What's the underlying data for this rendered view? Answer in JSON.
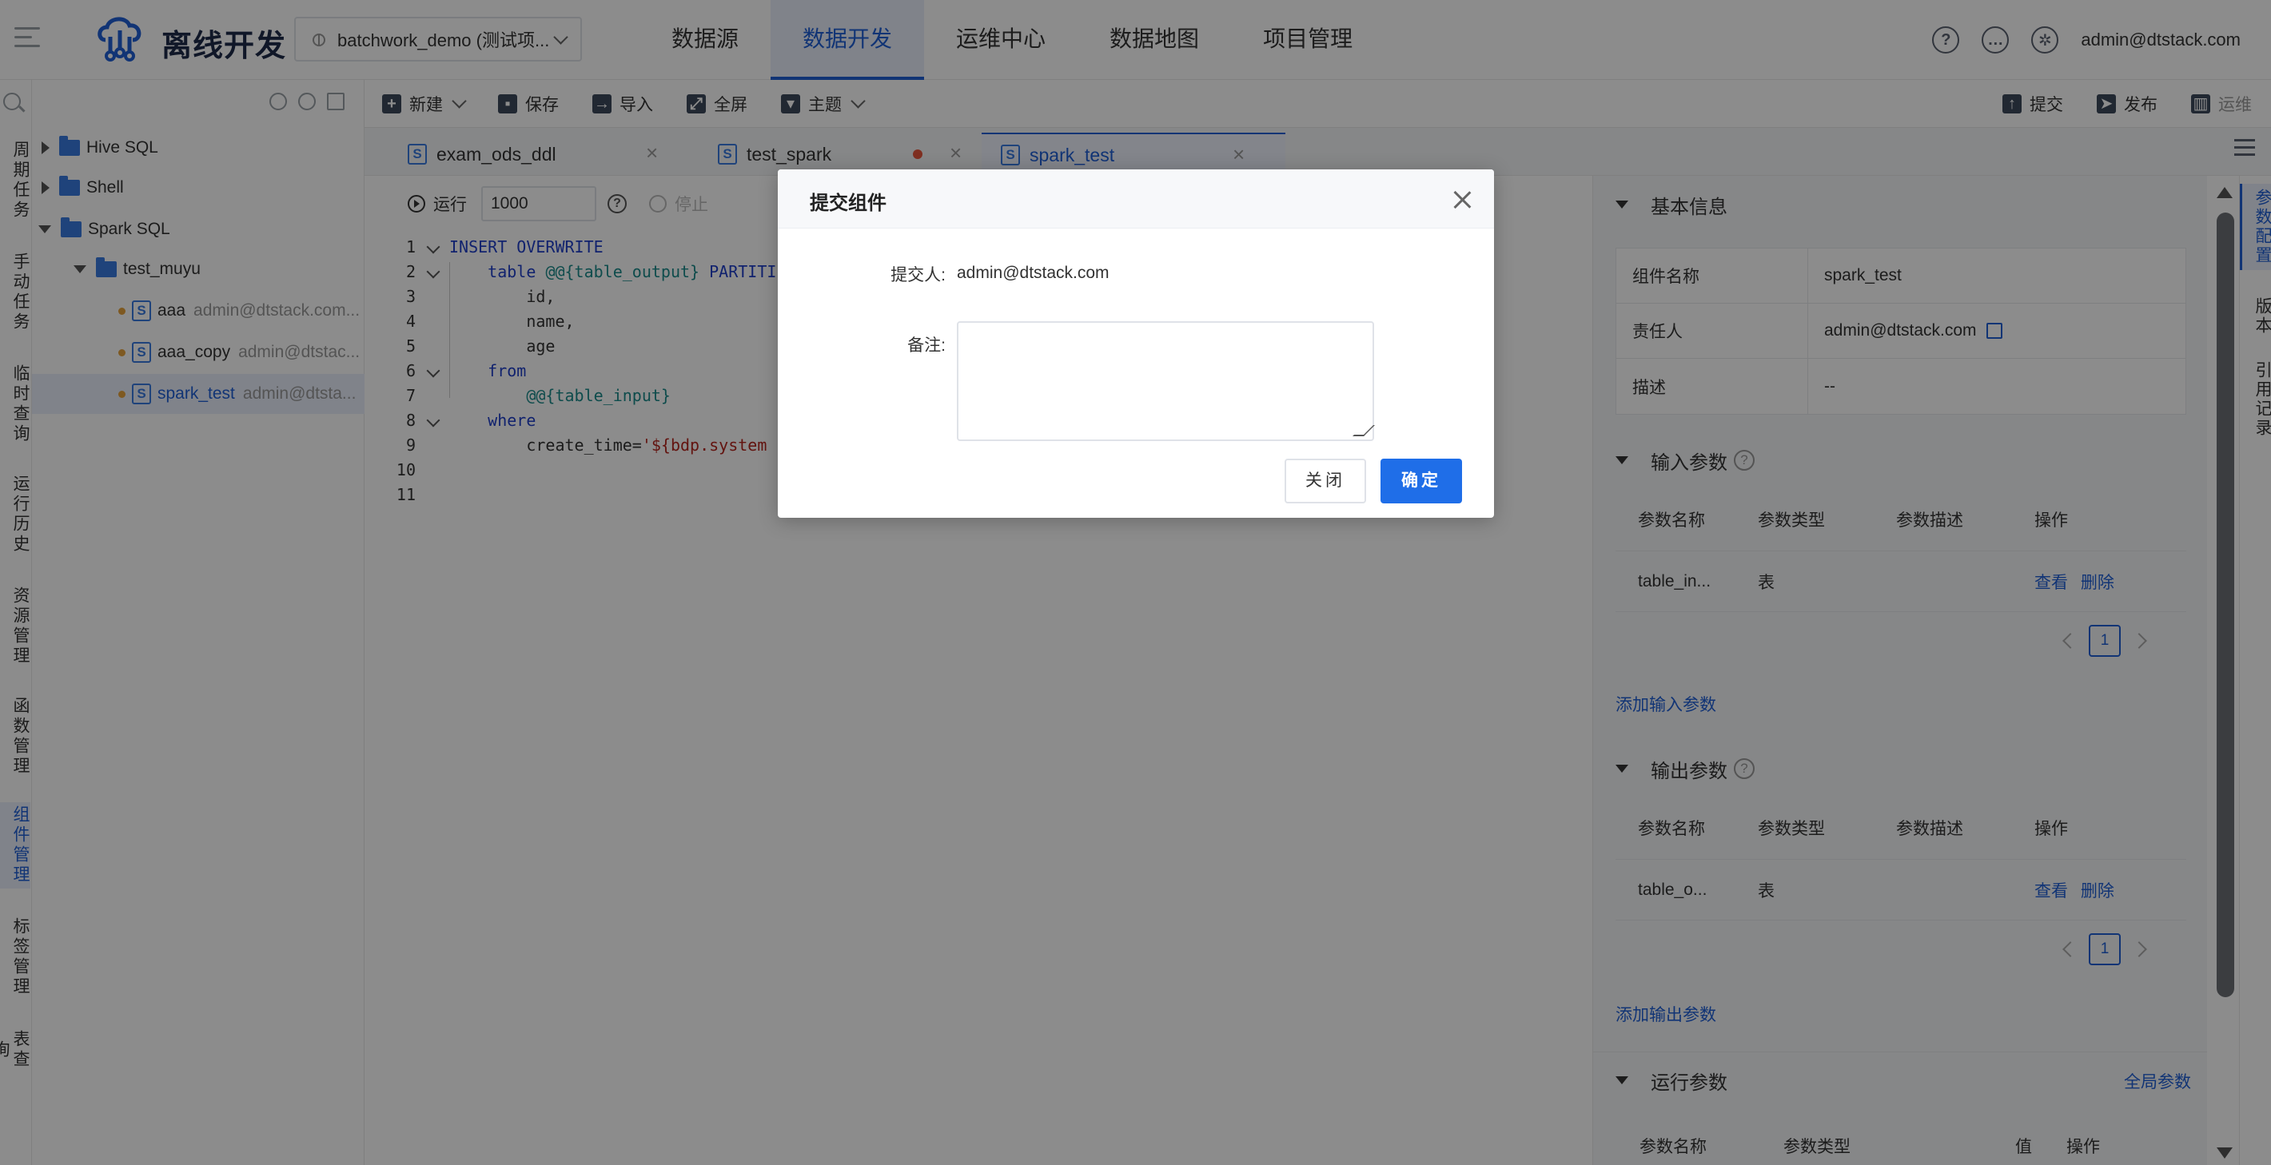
{
  "app": {
    "title": "离线开发",
    "project": "batchwork_demo (测试项..."
  },
  "nav": [
    "数据源",
    "数据开发",
    "运维中心",
    "数据地图",
    "项目管理"
  ],
  "user": {
    "email": "admin@dtstack.com"
  },
  "left_rail": [
    "周期任务",
    "手动任务",
    "临时查询",
    "运行历史",
    "资源管理",
    "函数管理",
    "组件管理",
    "标签管理",
    "表查询"
  ],
  "tree": {
    "folders": [
      "Hive SQL",
      "Shell",
      "Spark SQL",
      "test_muyu"
    ],
    "files": [
      {
        "name": "aaa",
        "owner": "admin@dtstack.com..."
      },
      {
        "name": "aaa_copy",
        "owner": "admin@dtstac..."
      },
      {
        "name": "spark_test",
        "owner": "admin@dtsta..."
      }
    ]
  },
  "toolbar": {
    "new": "新建",
    "save": "保存",
    "import": "导入",
    "fullscreen": "全屏",
    "theme": "主题",
    "submit": "提交",
    "publish": "发布",
    "ops": "运维"
  },
  "tabs": [
    "exam_ods_ddl",
    "test_spark",
    "spark_test"
  ],
  "editor": {
    "run": "运行",
    "limit": "1000",
    "stop": "停止",
    "lines": [
      {
        "n": "1",
        "parts": [
          [
            "kw",
            "INSERT OVERWRITE"
          ]
        ]
      },
      {
        "n": "2",
        "parts": [
          [
            "",
            "    "
          ],
          [
            "kw",
            "table"
          ],
          [
            "",
            " "
          ],
          [
            "var",
            "@@{table_output}"
          ],
          [
            "",
            " "
          ],
          [
            "kw",
            "PARTITI"
          ]
        ]
      },
      {
        "n": "3",
        "parts": [
          [
            "",
            "        id,"
          ]
        ]
      },
      {
        "n": "4",
        "parts": [
          [
            "",
            "        name,"
          ]
        ]
      },
      {
        "n": "5",
        "parts": [
          [
            "",
            "        age"
          ]
        ]
      },
      {
        "n": "6",
        "parts": [
          [
            "",
            "    "
          ],
          [
            "kw",
            "from"
          ]
        ]
      },
      {
        "n": "7",
        "parts": [
          [
            "",
            "        "
          ],
          [
            "var",
            "@@{table_input}"
          ]
        ]
      },
      {
        "n": "8",
        "parts": [
          [
            "",
            "    "
          ],
          [
            "kw",
            "where"
          ]
        ]
      },
      {
        "n": "9",
        "parts": [
          [
            "",
            "        create_time="
          ],
          [
            "str",
            "'${bdp.system"
          ]
        ]
      },
      {
        "n": "10",
        "parts": []
      },
      {
        "n": "11",
        "parts": []
      }
    ]
  },
  "right_panel": {
    "basic": {
      "title": "基本信息",
      "rows": [
        {
          "k": "组件名称",
          "v": "spark_test"
        },
        {
          "k": "责任人",
          "v": "admin@dtstack.com"
        },
        {
          "k": "描述",
          "v": "--"
        }
      ]
    },
    "columns": [
      "参数名称",
      "参数类型",
      "参数描述",
      "操作"
    ],
    "input": {
      "title": "输入参数",
      "row": [
        "table_in...",
        "表",
        ""
      ],
      "page": "1",
      "add": "添加输入参数"
    },
    "output": {
      "title": "输出参数",
      "row": [
        "table_o...",
        "表",
        ""
      ],
      "page": "1",
      "add": "添加输出参数"
    },
    "ops": {
      "view": "查看",
      "delete": "删除"
    },
    "runtime": {
      "title": "运行参数",
      "global": "全局参数",
      "columns": [
        "参数名称",
        "参数类型",
        "值",
        "操作"
      ]
    }
  },
  "right_rail": [
    "参数配置",
    "版本",
    "引用记录"
  ],
  "modal": {
    "title": "提交组件",
    "submitter_label": "提交人:",
    "submitter": "admin@dtstack.com",
    "remark_label": "备注:",
    "remark": "",
    "close": "关闭",
    "ok": "确定"
  },
  "colors": {
    "primary": "#1f6ee8",
    "accent": "#1f5fd6"
  }
}
